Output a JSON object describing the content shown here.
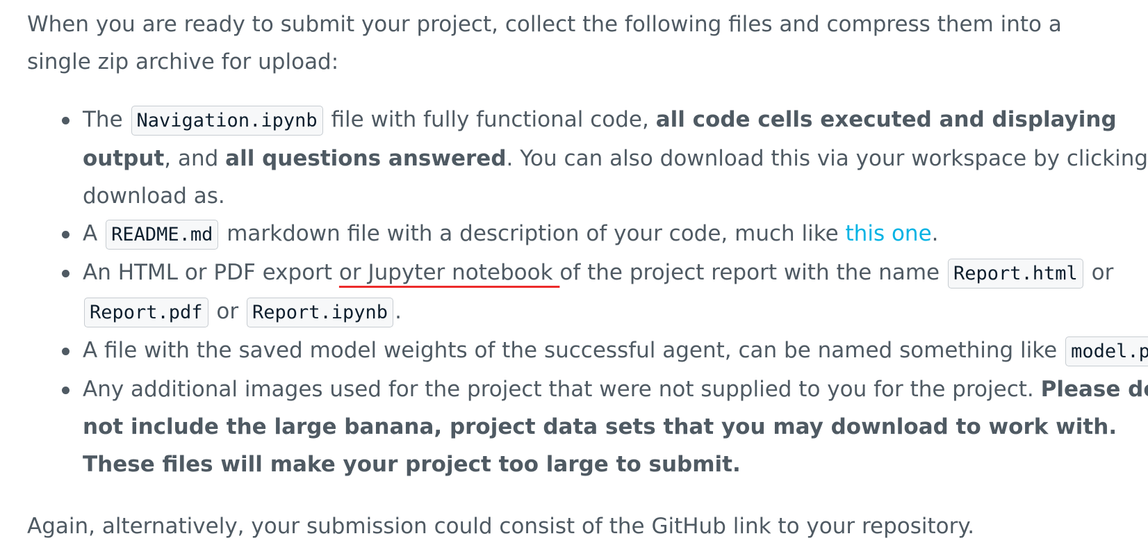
{
  "intro": "When you are ready to submit your project, collect the following files and compress them into a single zip archive for upload:",
  "items": [
    {
      "t1": "The ",
      "code1": "Navigation.ipynb",
      "t2": " file with fully functional code, ",
      "b1": "all code cells executed and displaying output",
      "t3": ", and ",
      "b2": "all questions answered",
      "t4": ". You can also download this via your workspace by clicking download as."
    },
    {
      "t1": "A ",
      "code1": "README.md",
      "t2": " markdown file with a description of your code, much like ",
      "link": "this one",
      "t3": "."
    },
    {
      "t1": "An HTML or PDF export ",
      "underlined": "or Jupyter notebook ",
      "t2": "of the project report with the name ",
      "code1": "Report.html",
      "t3": " or ",
      "code2": "Report.pdf",
      "t4": " or ",
      "code3": "Report.ipynb",
      "t5": "."
    },
    {
      "t1": "A file with the saved model weights of the successful agent, can be named something like ",
      "code1": "model.pt",
      "t2": "."
    },
    {
      "t1": "Any additional images used for the project that were not supplied to you for the project. ",
      "b1": "Please do not include the large banana, project data sets that you may download to work with. These files will make your project too large to submit."
    }
  ],
  "outro": "Again, alternatively, your submission could consist of the GitHub link to your repository.",
  "colors": {
    "text": "#4f5a63",
    "link": "#02b3e4",
    "underline": "#ec2b2b",
    "code_bg": "#f7f8f9",
    "code_border": "#c7ccd1"
  }
}
